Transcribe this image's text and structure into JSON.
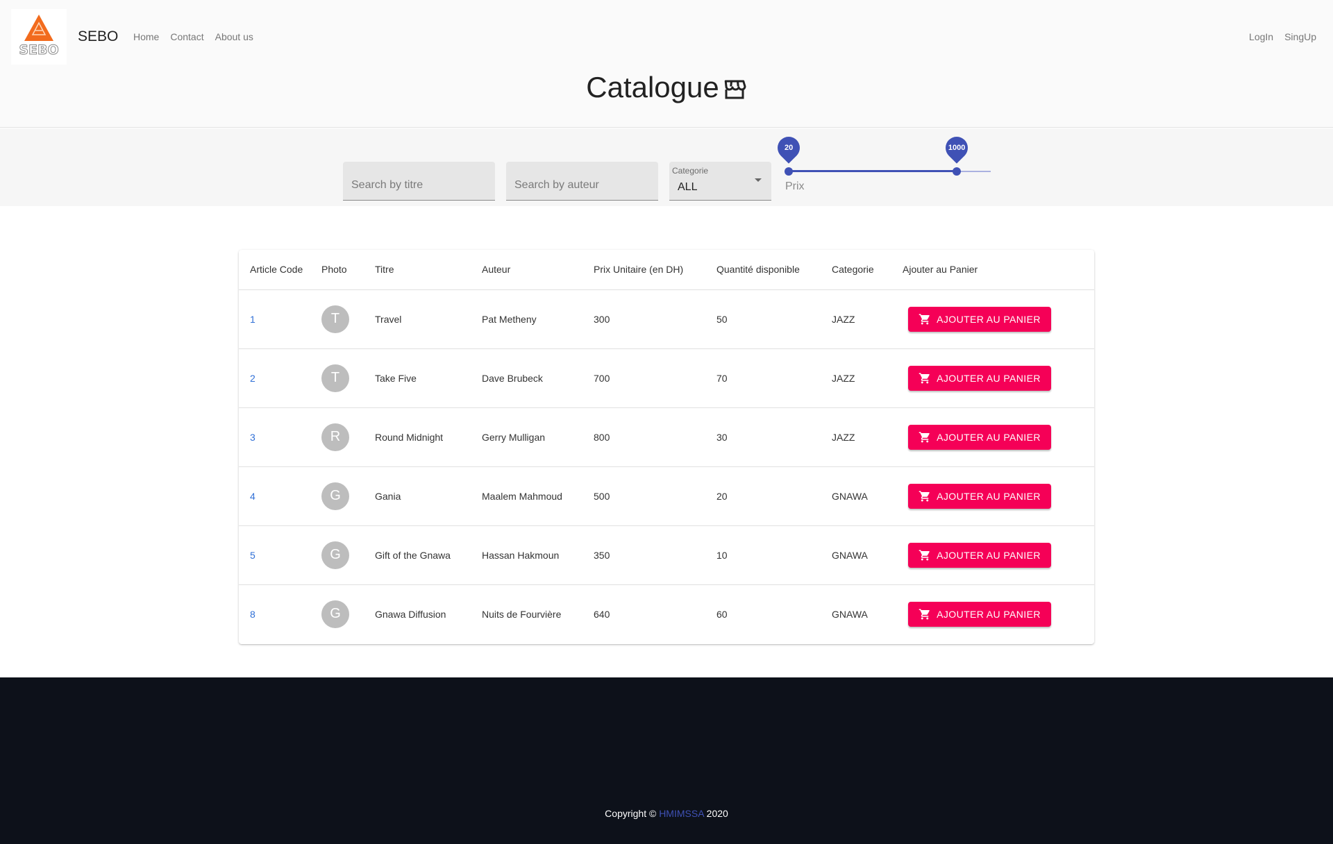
{
  "header": {
    "logo_text": "SEBO",
    "brand": "SEBO",
    "nav": [
      "Home",
      "Contact",
      "About us"
    ],
    "auth": [
      "LogIn",
      "SingUp"
    ],
    "title": "Catalogue"
  },
  "filters": {
    "title_placeholder": "Search by titre",
    "author_placeholder": "Search by auteur",
    "category_label": "Categorie",
    "category_value": "ALL",
    "price_label": "Prix",
    "price_min": "20",
    "price_max": "1000",
    "slider_range": [
      0,
      1200
    ]
  },
  "table": {
    "headers": [
      "Article Code",
      "Photo",
      "Titre",
      "Auteur",
      "Prix Unitaire (en DH)",
      "Quantité disponible",
      "Categorie",
      "Ajouter au Panier"
    ],
    "button_label": "AJOUTER AU PANIER",
    "rows": [
      {
        "code": "1",
        "avatar": "T",
        "titre": "Travel",
        "auteur": "Pat Metheny",
        "prix": "300",
        "qty": "50",
        "cat": "JAZZ"
      },
      {
        "code": "2",
        "avatar": "T",
        "titre": "Take Five",
        "auteur": "Dave Brubeck",
        "prix": "700",
        "qty": "70",
        "cat": "JAZZ"
      },
      {
        "code": "3",
        "avatar": "R",
        "titre": "Round Midnight",
        "auteur": "Gerry Mulligan",
        "prix": "800",
        "qty": "30",
        "cat": "JAZZ"
      },
      {
        "code": "4",
        "avatar": "G",
        "titre": "Gania",
        "auteur": "Maalem Mahmoud",
        "prix": "500",
        "qty": "20",
        "cat": "GNAWA"
      },
      {
        "code": "5",
        "avatar": "G",
        "titre": "Gift of the Gnawa",
        "auteur": "Hassan Hakmoun",
        "prix": "350",
        "qty": "10",
        "cat": "GNAWA"
      },
      {
        "code": "8",
        "avatar": "G",
        "titre": "Gnawa Diffusion",
        "auteur": "Nuits de Fourvière",
        "prix": "640",
        "qty": "60",
        "cat": "GNAWA"
      }
    ]
  },
  "footer": {
    "prefix": "Copyright © ",
    "link": "HMIMSSA",
    "year": " 2020"
  },
  "colors": {
    "accent": "#3f51b5",
    "button": "#f50057",
    "footer_bg": "#0d111a",
    "logo_orange": "#f26b1d"
  }
}
